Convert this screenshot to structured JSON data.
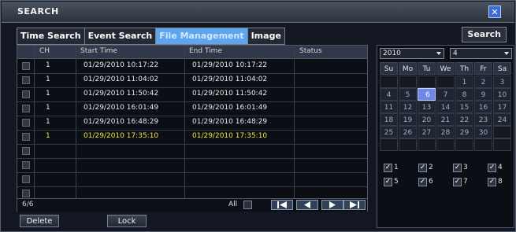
{
  "window": {
    "title": "SEARCH",
    "close_icon": "close-icon"
  },
  "tabs": [
    {
      "label": "Time Search",
      "active": false
    },
    {
      "label": "Event Search",
      "active": false
    },
    {
      "label": "File Management",
      "active": true
    },
    {
      "label": "Image",
      "active": false
    }
  ],
  "search_button": "Search",
  "table": {
    "columns": [
      "CH",
      "Start Time",
      "End Time",
      "Status"
    ],
    "rows": [
      {
        "ch": "1",
        "start": "01/29/2010 10:17:22",
        "end": "01/29/2010 10:17:22",
        "status": "",
        "highlight": false
      },
      {
        "ch": "1",
        "start": "01/29/2010 11:04:02",
        "end": "01/29/2010 11:04:02",
        "status": "",
        "highlight": false
      },
      {
        "ch": "1",
        "start": "01/29/2010 11:50:42",
        "end": "01/29/2010 11:50:42",
        "status": "",
        "highlight": false
      },
      {
        "ch": "1",
        "start": "01/29/2010 16:01:49",
        "end": "01/29/2010 16:01:49",
        "status": "",
        "highlight": false
      },
      {
        "ch": "1",
        "start": "01/29/2010 16:48:29",
        "end": "01/29/2010 16:48:29",
        "status": "",
        "highlight": false
      },
      {
        "ch": "1",
        "start": "01/29/2010 17:35:10",
        "end": "01/29/2010 17:35:10",
        "status": "",
        "highlight": true
      },
      {
        "ch": "",
        "start": "",
        "end": "",
        "status": "",
        "highlight": false
      },
      {
        "ch": "",
        "start": "",
        "end": "",
        "status": "",
        "highlight": false
      },
      {
        "ch": "",
        "start": "",
        "end": "",
        "status": "",
        "highlight": false
      },
      {
        "ch": "",
        "start": "",
        "end": "",
        "status": "",
        "highlight": false
      }
    ],
    "count": "6/6",
    "all_label": "All"
  },
  "nav": {
    "first_icon": "skip-first-icon",
    "prev_icon": "prev-icon",
    "next_icon": "next-icon",
    "last_icon": "skip-last-icon"
  },
  "buttons": {
    "delete": "Delete",
    "lock": "Lock"
  },
  "calendar": {
    "year": "2010",
    "month": "4",
    "weekdays": [
      "Su",
      "Mo",
      "Tu",
      "We",
      "Th",
      "Fr",
      "Sa"
    ],
    "selected_day": "6",
    "weeks": [
      [
        "",
        "",
        "",
        "",
        "1",
        "2",
        "3"
      ],
      [
        "4",
        "5",
        "6",
        "7",
        "8",
        "9",
        "10"
      ],
      [
        "11",
        "12",
        "13",
        "14",
        "15",
        "16",
        "17"
      ],
      [
        "18",
        "19",
        "20",
        "21",
        "22",
        "23",
        "24"
      ],
      [
        "25",
        "26",
        "27",
        "28",
        "29",
        "30",
        ""
      ],
      [
        "",
        "",
        "",
        "",
        "",
        "",
        ""
      ]
    ]
  },
  "channels": [
    {
      "label": "1",
      "checked": true
    },
    {
      "label": "2",
      "checked": true
    },
    {
      "label": "3",
      "checked": true
    },
    {
      "label": "4",
      "checked": true
    },
    {
      "label": "5",
      "checked": true
    },
    {
      "label": "6",
      "checked": true
    },
    {
      "label": "7",
      "checked": true
    },
    {
      "label": "8",
      "checked": true
    }
  ],
  "colors": {
    "highlight_text": "#f1e33c",
    "active_tab": "#5fa4ee",
    "selected_day": "#6d88e6"
  }
}
